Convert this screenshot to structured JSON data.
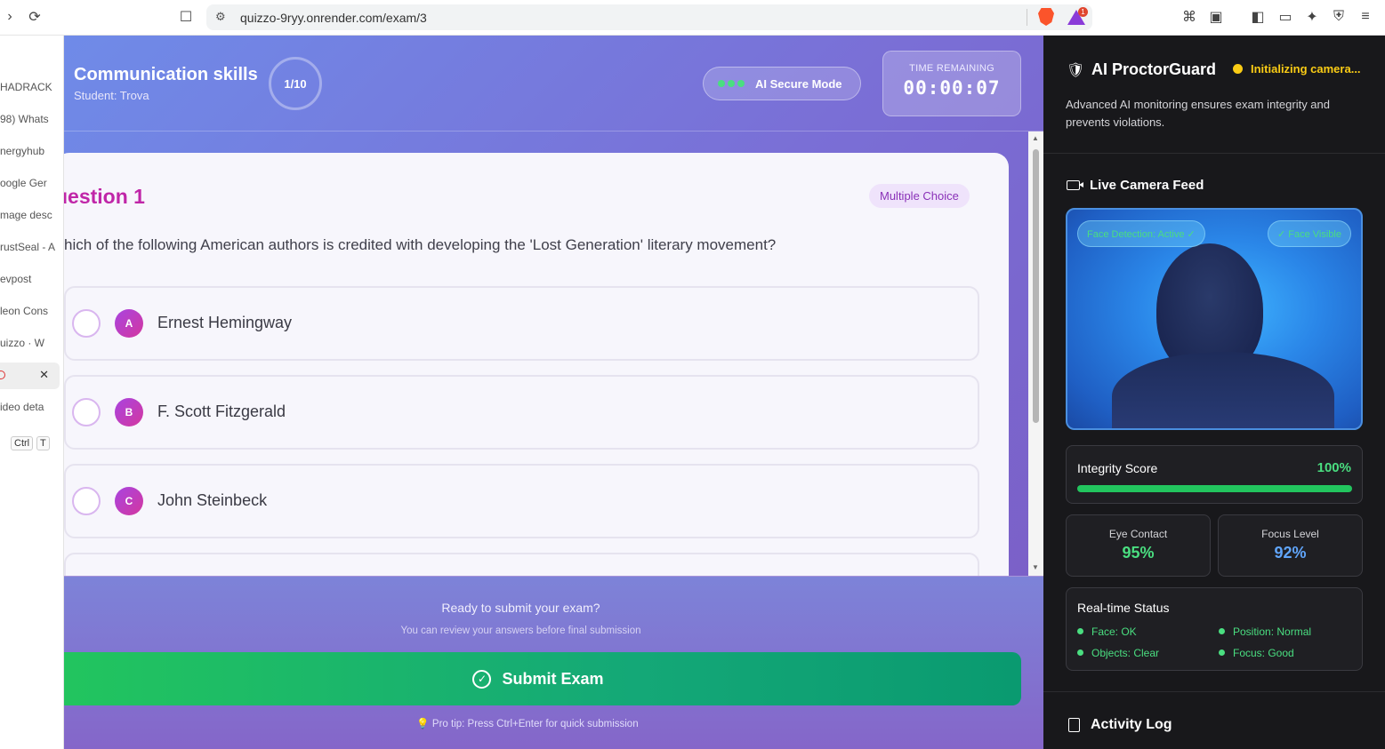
{
  "browser": {
    "url": "quizzo-9ryy.onrender.com/exam/3",
    "bat_badge": "1"
  },
  "sidebar_tabs": [
    {
      "label": "HADRACK"
    },
    {
      "label": "98) Whats"
    },
    {
      "label": "nergyhub"
    },
    {
      "label": "oogle Ger"
    },
    {
      "label": "mage desc"
    },
    {
      "label": "rustSeal - A"
    },
    {
      "label": "evpost"
    },
    {
      "label": "leon Cons"
    },
    {
      "label": "uizzo · W"
    },
    {
      "label": ""
    },
    {
      "label": "ideo deta"
    }
  ],
  "sidebar_shortcut": {
    "key1": "Ctrl",
    "key2": "T"
  },
  "header": {
    "course_title": "Communication skills",
    "student": "Student: Trova",
    "progress": "1/10",
    "secure_mode": "AI Secure Mode",
    "timer_label": "TIME REMAINING",
    "timer_value": "00:00:07"
  },
  "question": {
    "title": "uestion 1",
    "type_badge": "Multiple Choice",
    "text": "hich of the following American authors is credited with developing the 'Lost Generation' literary movement?",
    "options": [
      {
        "letter": "A",
        "text": "Ernest Hemingway"
      },
      {
        "letter": "B",
        "text": "F. Scott Fitzgerald"
      },
      {
        "letter": "C",
        "text": "John Steinbeck"
      }
    ]
  },
  "submit": {
    "question": "Ready to submit your exam?",
    "subtitle": "You can review your answers before final submission",
    "button_label": "Submit Exam",
    "pro_tip": "Pro tip: Press Ctrl+Enter for quick submission"
  },
  "proctor": {
    "title": "AI ProctorGuard",
    "status": "Initializing camera...",
    "description": "Advanced AI monitoring ensures exam integrity and prevents violations.",
    "camera_title": "Live Camera Feed",
    "face_detection": "Face Detection: Active ✓",
    "face_visible": "✓ Face Visible",
    "integrity_label": "Integrity Score",
    "integrity_value": "100%",
    "integrity_fraction": 1.0,
    "eye_contact_label": "Eye Contact",
    "eye_contact_value": "95%",
    "focus_label": "Focus Level",
    "focus_value": "92%",
    "realtime_title": "Real-time Status",
    "status_items": {
      "face": "Face: OK",
      "position": "Position: Normal",
      "objects": "Objects: Clear",
      "focus": "Focus: Good"
    },
    "activity_title": "Activity Log"
  },
  "colors": {
    "accent_green": "#22c55e",
    "status_yellow": "#facc15",
    "question_title": "#c026a8",
    "focus_blue": "#60a5fa"
  }
}
